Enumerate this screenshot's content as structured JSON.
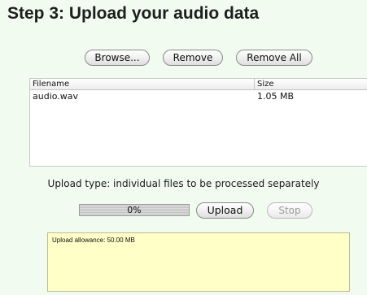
{
  "heading": "Step 3: Upload your audio data",
  "buttons": {
    "browse": "Browse...",
    "remove": "Remove",
    "remove_all": "Remove All",
    "upload": "Upload",
    "stop": "Stop"
  },
  "file_table": {
    "columns": [
      "Filename",
      "Size"
    ],
    "rows": [
      {
        "filename": "audio.wav",
        "size": "1.05 MB"
      }
    ]
  },
  "upload_type_text": "Upload type: individual files to be processed separately",
  "progress": {
    "label": "0%",
    "fraction": 0
  },
  "allowance_text": "Upload allowance: 50.00 MB",
  "colors": {
    "panel_background": "#f1fbf0",
    "allowance_background": "#ffffc8"
  }
}
